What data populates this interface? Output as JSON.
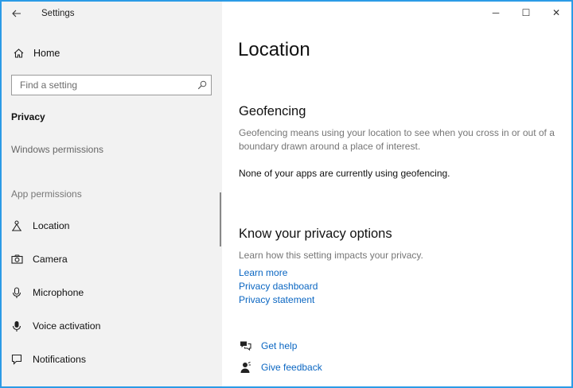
{
  "window": {
    "app_title": "Settings",
    "caption": {
      "minimize": "─",
      "maximize": "☐",
      "close": "✕"
    }
  },
  "sidebar": {
    "home_label": "Home",
    "search_placeholder": "Find a setting",
    "section_privacy": "Privacy",
    "windows_permissions": "Windows permissions",
    "section_app_permissions": "App permissions",
    "items": [
      {
        "label": "Location",
        "icon": "location-icon"
      },
      {
        "label": "Camera",
        "icon": "camera-icon"
      },
      {
        "label": "Microphone",
        "icon": "microphone-icon"
      },
      {
        "label": "Voice activation",
        "icon": "voice-activation-icon"
      },
      {
        "label": "Notifications",
        "icon": "notifications-icon"
      }
    ]
  },
  "main": {
    "title": "Location",
    "geofencing": {
      "heading": "Geofencing",
      "description": "Geofencing means using your location to see when you cross in or out of a boundary drawn around a place of interest.",
      "status": "None of your apps are currently using geofencing."
    },
    "privacy": {
      "heading": "Know your privacy options",
      "description": "Learn how this setting impacts your privacy.",
      "links": [
        "Learn more",
        "Privacy dashboard",
        "Privacy statement"
      ]
    },
    "help": {
      "get_help": "Get help",
      "give_feedback": "Give feedback"
    }
  },
  "colors": {
    "accent": "#0a66c2",
    "window_border": "#2b9be6",
    "sidebar_bg": "#f2f2f2"
  }
}
